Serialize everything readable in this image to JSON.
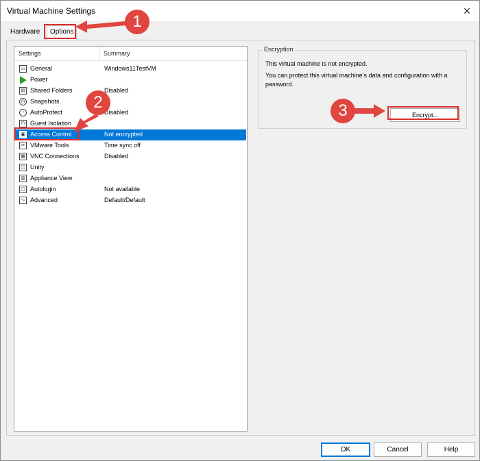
{
  "window": {
    "title": "Virtual Machine Settings"
  },
  "tabs": [
    {
      "label": "Hardware"
    },
    {
      "label": "Options"
    }
  ],
  "list": {
    "headers": {
      "settings": "Settings",
      "summary": "Summary"
    },
    "rows": [
      {
        "label": "General",
        "summary": "Windows11TestVM",
        "icon": "general-icon"
      },
      {
        "label": "Power",
        "summary": "",
        "icon": "power-icon"
      },
      {
        "label": "Shared Folders",
        "summary": "Disabled",
        "icon": "shared-folders-icon"
      },
      {
        "label": "Snapshots",
        "summary": "",
        "icon": "snapshots-icon"
      },
      {
        "label": "AutoProtect",
        "summary": "Disabled",
        "icon": "autoprotect-icon"
      },
      {
        "label": "Guest Isolation",
        "summary": "",
        "icon": "guest-isolation-icon"
      },
      {
        "label": "Access Control",
        "summary": "Not encrypted",
        "icon": "access-control-icon"
      },
      {
        "label": "VMware Tools",
        "summary": "Time sync off",
        "icon": "vmware-tools-icon"
      },
      {
        "label": "VNC Connections",
        "summary": "Disabled",
        "icon": "vnc-connections-icon"
      },
      {
        "label": "Unity",
        "summary": "",
        "icon": "unity-icon"
      },
      {
        "label": "Appliance View",
        "summary": "",
        "icon": "appliance-view-icon"
      },
      {
        "label": "Autologin",
        "summary": "Not available",
        "icon": "autologin-icon"
      },
      {
        "label": "Advanced",
        "summary": "Default/Default",
        "icon": "advanced-icon"
      }
    ]
  },
  "encryption": {
    "group_title": "Encryption",
    "status": "This virtual machine is not encrypted.",
    "description": "You can protect this virtual machine's data and configuration with a password.",
    "button": "Encrypt..."
  },
  "footer": {
    "ok": "OK",
    "cancel": "Cancel",
    "help": "Help"
  },
  "annotations": {
    "one": "1",
    "two": "2",
    "three": "3",
    "accent": "#e1453f"
  }
}
